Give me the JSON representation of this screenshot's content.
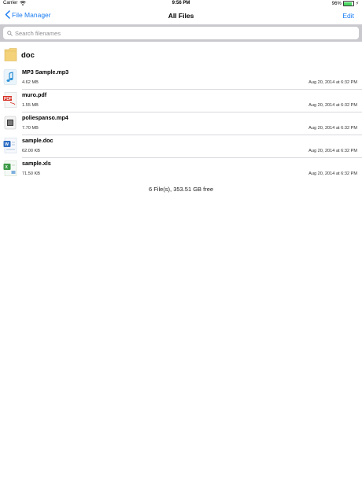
{
  "status_bar": {
    "carrier": "Carrier",
    "time": "9:56 PM",
    "battery": "96%",
    "battery_level": 0.96
  },
  "nav": {
    "back_label": "File Manager",
    "title": "All Files",
    "edit_label": "Edit"
  },
  "search": {
    "placeholder": "Search filenames"
  },
  "folder": {
    "name": "doc"
  },
  "files": [
    {
      "name": "MP3 Sample.mp3",
      "size": "4.62 MB",
      "date": "Aug 20, 2014 at 6:32 PM",
      "icon": "audio-file-icon"
    },
    {
      "name": "muro.pdf",
      "size": "1.55 MB",
      "date": "Aug 20, 2014 at 6:32 PM",
      "icon": "pdf-file-icon"
    },
    {
      "name": "poliespanso.mp4",
      "size": "7.70 MB",
      "date": "Aug 20, 2014 at 6:32 PM",
      "icon": "video-file-icon"
    },
    {
      "name": "sample.doc",
      "size": "62.00 KB",
      "date": "Aug 20, 2014 at 6:32 PM",
      "icon": "doc-file-icon"
    },
    {
      "name": "sample.xls",
      "size": "71.50 KB",
      "date": "Aug 20, 2014 at 6:32 PM",
      "icon": "xls-file-icon"
    }
  ],
  "footer": {
    "summary": "6 File(s), 353.51 GB free"
  },
  "colors": {
    "accent": "#1a7cf2",
    "search_bar_bg": "#c9c9ce",
    "battery_green": "#4cd964",
    "folder_yellow": "#f3d27a"
  }
}
